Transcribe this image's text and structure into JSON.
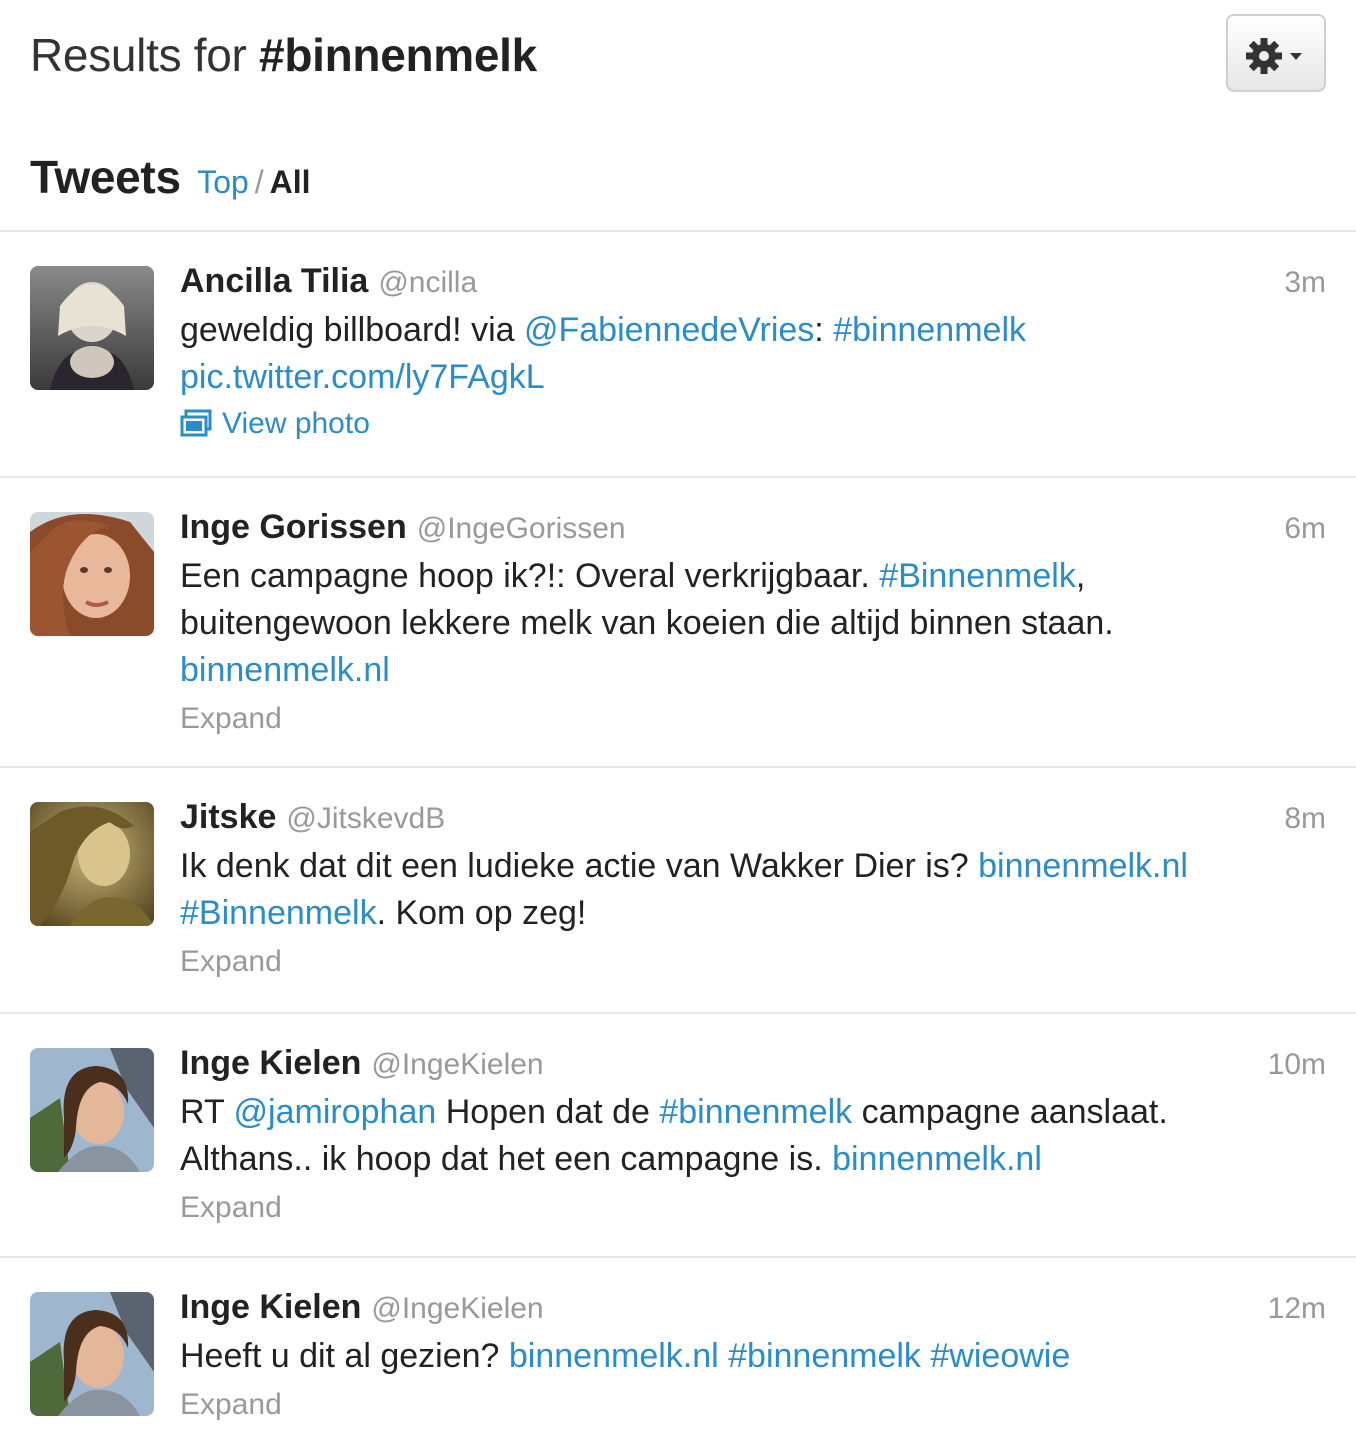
{
  "header": {
    "results_prefix": "Results for",
    "query": "#binnenmelk"
  },
  "subhead": {
    "title": "Tweets",
    "top_label": "Top",
    "separator": "/",
    "all_label": "All"
  },
  "colors": {
    "link": "#2a8cc9",
    "muted": "#999999",
    "text": "#222222",
    "divider": "#e8e8e8"
  },
  "tweets": [
    {
      "name": "Ancilla Tilia",
      "handle": "@ncilla",
      "time": "3m",
      "text": [
        [
          {
            "t": "geweldig billboard! via "
          },
          {
            "t": "@FabiennedeVries",
            "link": true
          },
          {
            "t": ": "
          },
          {
            "t": "#binnenmelk",
            "link": true
          }
        ],
        [
          {
            "t": "pic.twitter.com/ly7FAgkL",
            "link": true
          }
        ]
      ],
      "action": "View photo",
      "action_type": "photo",
      "avatar_icon": "avatar-ancilla"
    },
    {
      "name": "Inge Gorissen",
      "handle": "@IngeGorissen",
      "time": "6m",
      "text": [
        [
          {
            "t": "Een campagne hoop ik?!: Overal verkrijgbaar. "
          },
          {
            "t": "#Binnenmelk",
            "link": true
          },
          {
            "t": ","
          }
        ],
        [
          {
            "t": "buitengewoon lekkere melk van koeien die altijd binnen staan."
          }
        ],
        [
          {
            "t": "binnenmelk.nl",
            "link": true
          }
        ]
      ],
      "action": "Expand",
      "action_type": "expand",
      "avatar_icon": "avatar-inge-gorissen"
    },
    {
      "name": "Jitske",
      "handle": "@JitskevdB",
      "time": "8m",
      "text": [
        [
          {
            "t": "Ik denk dat dit een ludieke actie van Wakker Dier is? "
          },
          {
            "t": "binnenmelk.nl",
            "link": true
          }
        ],
        [
          {
            "t": "#Binnenmelk",
            "link": true
          },
          {
            "t": ". Kom op zeg!"
          }
        ]
      ],
      "action": "Expand",
      "action_type": "expand",
      "avatar_icon": "avatar-jitske"
    },
    {
      "name": "Inge Kielen",
      "handle": "@IngeKielen",
      "time": "10m",
      "text": [
        [
          {
            "t": "RT "
          },
          {
            "t": "@jamirophan",
            "link": true
          },
          {
            "t": " Hopen dat de "
          },
          {
            "t": "#binnenmelk",
            "link": true
          },
          {
            "t": " campagne aanslaat."
          }
        ],
        [
          {
            "t": "Althans.. ik hoop dat het een campagne is. "
          },
          {
            "t": "binnenmelk.nl",
            "link": true
          }
        ]
      ],
      "action": "Expand",
      "action_type": "expand",
      "avatar_icon": "avatar-inge-kielen"
    },
    {
      "name": "Inge Kielen",
      "handle": "@IngeKielen",
      "time": "12m",
      "text": [
        [
          {
            "t": "Heeft u dit al gezien? "
          },
          {
            "t": "binnenmelk.nl",
            "link": true
          },
          {
            "t": " "
          },
          {
            "t": "#binnenmelk",
            "link": true
          },
          {
            "t": " "
          },
          {
            "t": "#wieowie",
            "link": true
          }
        ]
      ],
      "action": "Expand",
      "action_type": "expand",
      "avatar_icon": "avatar-inge-kielen"
    }
  ]
}
